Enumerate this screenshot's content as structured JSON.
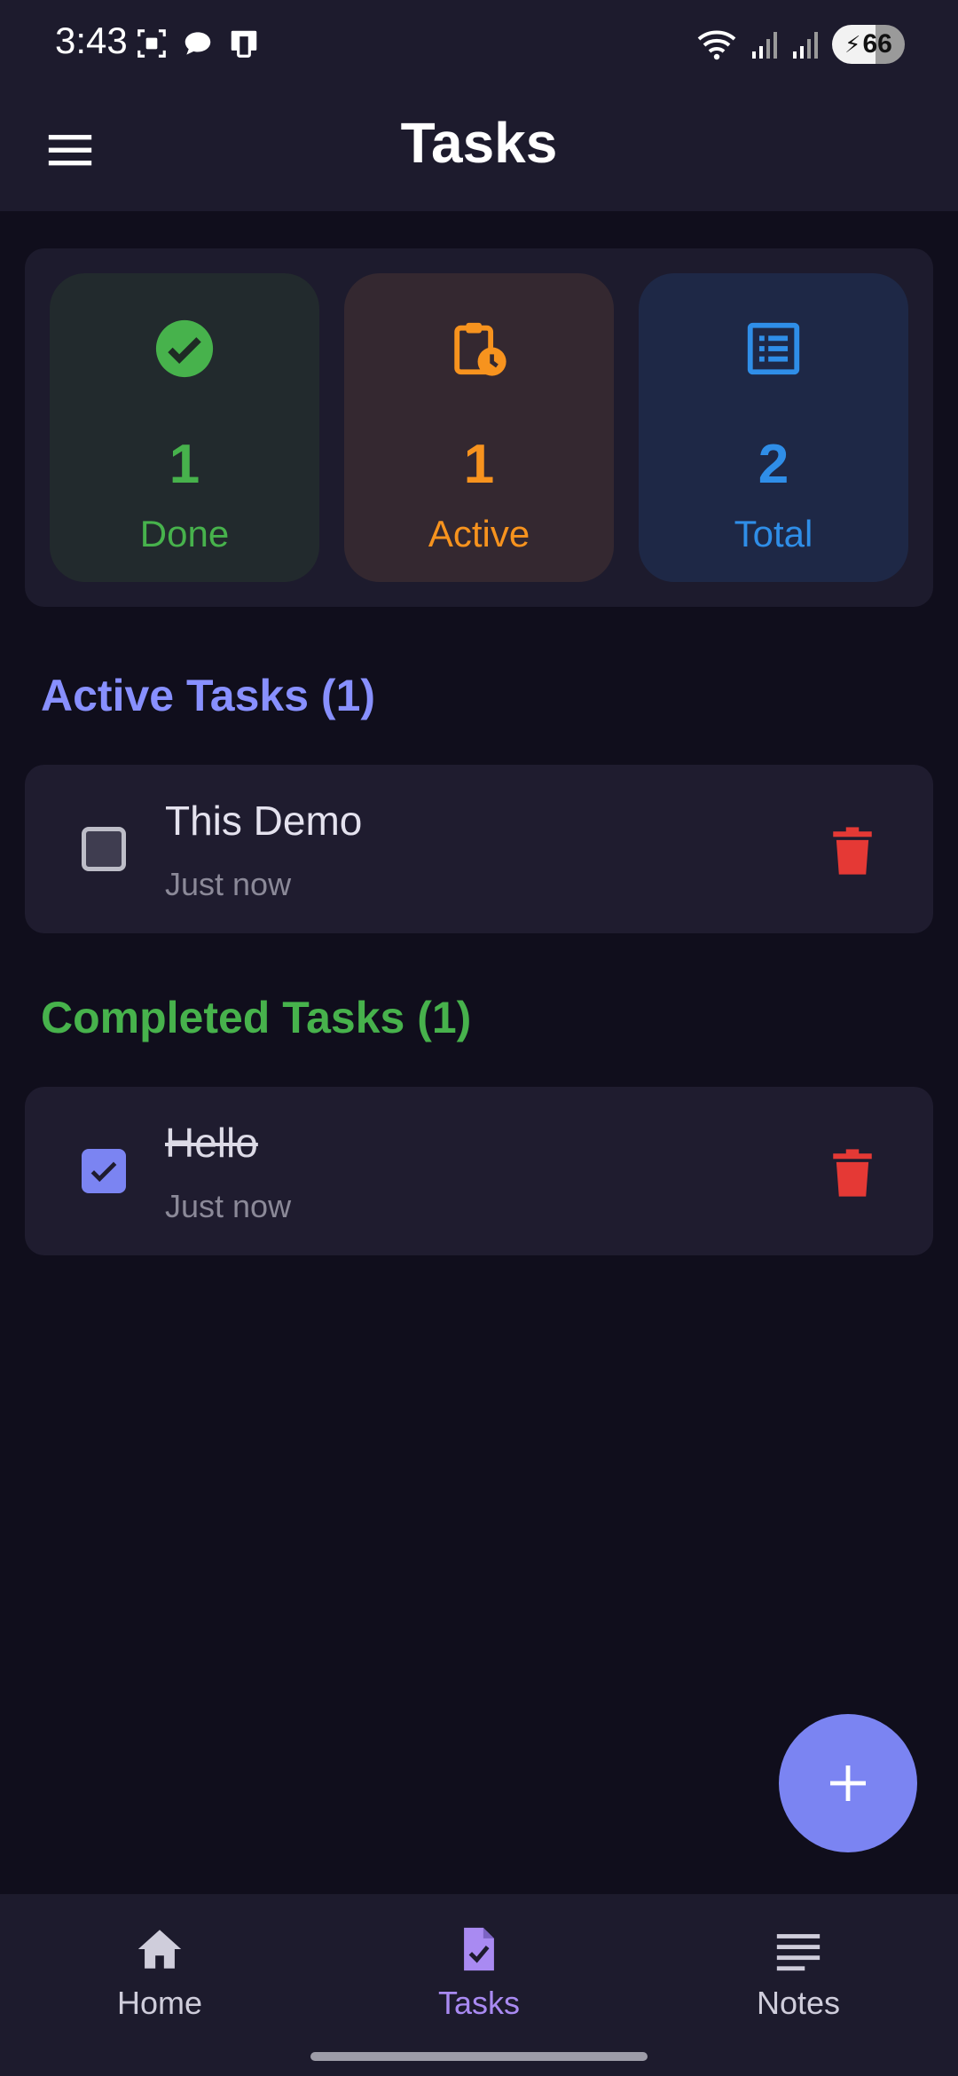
{
  "status_bar": {
    "time": "3:43",
    "battery": "66"
  },
  "app_bar": {
    "title": "Tasks",
    "menu_icon": "menu-icon"
  },
  "stats": {
    "done": {
      "count": "1",
      "label": "Done",
      "icon": "check-circle-icon",
      "color": "#47b24c"
    },
    "active": {
      "count": "1",
      "label": "Active",
      "icon": "clipboard-clock-icon",
      "color": "#f7931e"
    },
    "total": {
      "count": "2",
      "label": "Total",
      "icon": "list-icon",
      "color": "#2f8ee8"
    }
  },
  "active_section": {
    "title": "Active Tasks (1)",
    "tasks": [
      {
        "title": "This Demo",
        "time": "Just now",
        "checked": false
      }
    ]
  },
  "completed_section": {
    "title": "Completed Tasks (1)",
    "tasks": [
      {
        "title": "Hello",
        "time": "Just now",
        "checked": true
      }
    ]
  },
  "fab": {
    "icon": "plus-icon"
  },
  "bottom_nav": {
    "items": [
      {
        "label": "Home",
        "icon": "home-icon",
        "selected": false
      },
      {
        "label": "Tasks",
        "icon": "task-file-icon",
        "selected": true
      },
      {
        "label": "Notes",
        "icon": "notes-lines-icon",
        "selected": false
      }
    ]
  },
  "colors": {
    "accent": "#7b84f2",
    "delete": "#e53935",
    "background": "#100e1c",
    "surface": "#1d1b2d"
  }
}
